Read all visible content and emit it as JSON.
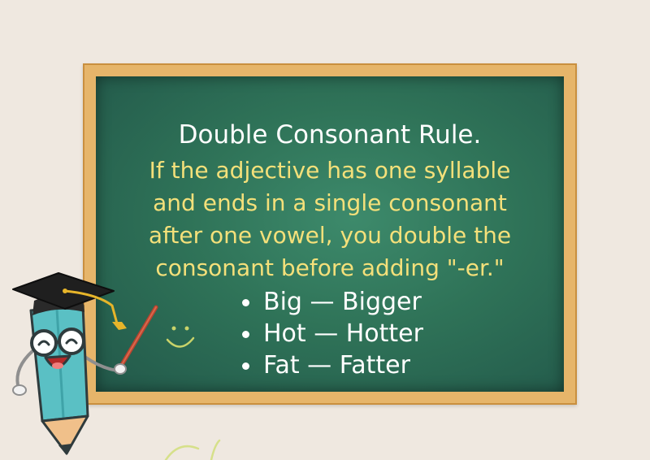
{
  "board": {
    "title": "Double Consonant Rule.",
    "rule_lines": [
      "If the adjective has one syllable",
      "and ends in a single consonant",
      "after one vowel, you double the",
      "consonant before adding \"-er.\""
    ],
    "examples": [
      "Big — Bigger",
      "Hot — Hotter",
      "Fat — Fatter"
    ]
  },
  "colors": {
    "page_background": "#efe8e0",
    "board_green": "#2f7358",
    "frame_wood": "#e6b56a",
    "title_text": "#ffffff",
    "rule_text": "#f4e07a"
  },
  "illustrations": {
    "mascot": "pencil-teacher-icon",
    "hat": "graduation-cap-icon",
    "pointer": "pointer-stick-icon",
    "chalk_face": "smiley-doodle-icon"
  }
}
